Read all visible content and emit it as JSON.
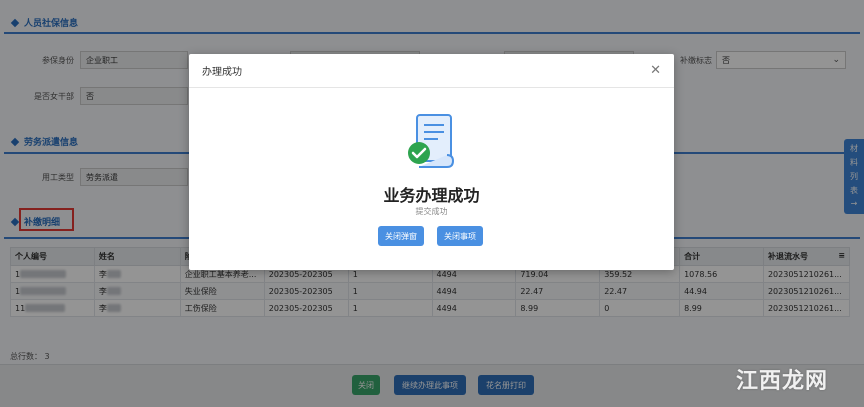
{
  "sections": {
    "personnel": "人员社保信息",
    "dispatch": "劳务派遣信息",
    "supplement": "补缴明细"
  },
  "fields": {
    "insured_identity_label": "参保身份",
    "insured_identity_value": "企业职工",
    "female_cadre_label": "是否女干部",
    "female_cadre_value": "否",
    "payment_flag_label": "补缴标志",
    "payment_flag_value": "否",
    "employment_type_label": "用工类型",
    "employment_type_value": "劳务派遣"
  },
  "table": {
    "headers": [
      "个人编号",
      "姓名",
      "险种",
      "",
      "",
      "",
      "",
      "",
      "合计",
      "补退流水号"
    ],
    "rows": [
      {
        "id": "1",
        "name": "李",
        "type": "企业职工基本养老...",
        "period": "202305-202305",
        "months": "1",
        "base": "4494",
        "unit": "719.04",
        "person": "359.52",
        "total": "1078.56",
        "serial": "2023051210261..."
      },
      {
        "id": "1",
        "name": "李",
        "type": "失业保险",
        "period": "202305-202305",
        "months": "1",
        "base": "4494",
        "unit": "22.47",
        "person": "22.47",
        "total": "44.94",
        "serial": "2023051210261..."
      },
      {
        "id": "11",
        "name": "李",
        "type": "工伤保险",
        "period": "202305-202305",
        "months": "1",
        "base": "4494",
        "unit": "8.99",
        "person": "0",
        "total": "8.99",
        "serial": "2023051210261..."
      }
    ],
    "row_count": "总行数： 3"
  },
  "bottom_buttons": {
    "close": "关闭",
    "continue": "继续办理此事项",
    "roster_print": "花名册打印"
  },
  "side_tab": [
    "材",
    "料",
    "列",
    "表"
  ],
  "modal": {
    "title": "办理成功",
    "headline": "业务办理成功",
    "subtitle": "提交成功",
    "close_popup": "关闭弹窗",
    "close_item": "关闭事项"
  },
  "watermark": "江西龙网",
  "colors": {
    "primary": "#4a90e2",
    "section": "#2a6fc0",
    "success": "#2ea44f",
    "green_button": "#3aa66b"
  }
}
